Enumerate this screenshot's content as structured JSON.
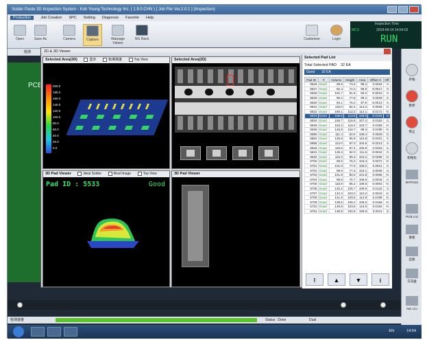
{
  "window": {
    "title": "Solder Paste 3D Inspection System - Koh Young Technology Inc. ( 1.9.0.CHN ) [ Job File Ver.2.0.1 ] (Inspection)"
  },
  "menu": [
    "Production",
    "Job Creation",
    "SPC",
    "Setting",
    "Diagnosis",
    "Favorite",
    "Help"
  ],
  "toolbar": [
    "Open",
    "Save As",
    "Camera",
    "Capture",
    "Warpage Viewer",
    "NG Rack",
    "Customize",
    "Login"
  ],
  "status": {
    "label": "Inspection Time",
    "mode": "MCS",
    "datetime": "2018-04-14 14:54:02",
    "state": "RUN"
  },
  "detect_label": "检测",
  "pcb_label": "PCB",
  "dialog": {
    "title": "2D & 3D Viewer"
  },
  "selected3d": {
    "title": "Selected Area(3D)",
    "opts": [
      "显示",
      "标准高度",
      "Top View"
    ],
    "legend": [
      "200.0",
      "180.0",
      "160.0",
      "140.0",
      "120.0",
      "100.0",
      "80.0",
      "60.0",
      "40.0",
      "20.0",
      "0.0"
    ]
  },
  "selected2d": {
    "title": "Selected Area(2D)"
  },
  "pad3dviewer": {
    "title": "3D Pad Viewer",
    "opts": [
      "Ideal Solder",
      "Real Image",
      "Top View"
    ],
    "pad_id": "Pad ID : 5533",
    "result": "Good"
  },
  "pad2dviewer": {
    "title": "3D Pad Viewer"
  },
  "padlist": {
    "title": "Selected Pad List",
    "total_label": "Total Selected PAD",
    "total_value": "32 EA",
    "filter_label": "Good",
    "filter_value": "32 EA"
  },
  "table": {
    "columns": [
      "Pad ID",
      "#",
      "Volume",
      "Height",
      "Area",
      "Offset X",
      "Off"
    ],
    "rows": [
      [
        "5526",
        "Good",
        "99.5",
        "73.6",
        "98.2",
        "0.0034",
        "0."
      ],
      [
        "5527",
        "Good",
        "92.4",
        "74.3",
        "99.5",
        "-0.0017",
        "0."
      ],
      [
        "5528",
        "Good",
        "101.7",
        "81.9",
        "99.2",
        "-0.0010",
        "0."
      ],
      [
        "5529",
        "Good",
        "96.2",
        "77.5",
        "99.2",
        "0.0028",
        "0."
      ],
      [
        "5530",
        "Good",
        "92.1",
        "75.2",
        "97.9",
        "-0.0013",
        "0."
      ],
      [
        "5531",
        "Good",
        "118.0",
        "82.4",
        "113.2",
        "0.0025",
        "0."
      ],
      [
        "5532",
        "Good",
        "160.1",
        "112.3",
        "114.1",
        "0.0171",
        "-0."
      ],
      [
        "5533",
        "Good",
        "156.5",
        "113.8",
        "109.9",
        "0.0103",
        "0."
      ],
      [
        "5534",
        "Good",
        "155.7",
        "115.8",
        "107.4",
        "0.0162",
        "0."
      ],
      [
        "5535",
        "Good",
        "153.3",
        "119.4",
        "103.7",
        "0.0158",
        "-0."
      ],
      [
        "5536",
        "Good",
        "145.8",
        "116.7",
        "98.3",
        "0.0198",
        "-0."
      ],
      [
        "5580",
        "Good",
        "111.4",
        "83.6",
        "108.4",
        "0.0529",
        "0."
      ],
      [
        "5584",
        "Good",
        "125.8",
        "96.9",
        "115.8",
        "-0.0201",
        "0."
      ],
      [
        "5585",
        "Good",
        "114.0",
        "87.0",
        "104.8",
        "-0.0213",
        "0."
      ],
      [
        "5626",
        "Good",
        "115.6",
        "87.4",
        "105.8",
        "0.0463",
        "0."
      ],
      [
        "5631",
        "Good",
        "128.4",
        "92.0",
        "111.6",
        "-0.0044",
        "0."
      ],
      [
        "5632",
        "Good",
        "116.3",
        "89.3",
        "104.2",
        "-0.0268",
        "-0."
      ],
      [
        "5700",
        "Good",
        "99.5",
        "76.2",
        "103.4",
        "0.0072",
        "-0."
      ],
      [
        "5701",
        "Good",
        "101.0",
        "77.6",
        "105.0",
        "0.0021",
        "0."
      ],
      [
        "5702",
        "Good",
        "99.6",
        "77.3",
        "103.1",
        "0.0028",
        "0."
      ],
      [
        "5703",
        "Good",
        "101.8",
        "80.0",
        "101.8",
        "0.0066",
        "-0."
      ],
      [
        "5704",
        "Good",
        "99.9",
        "75.7",
        "105.6",
        "0.0025",
        "0."
      ],
      [
        "5705",
        "Good",
        "115.9",
        "85.2",
        "108.8",
        "0.0063",
        "-0."
      ],
      [
        "5706",
        "Good",
        "145.2",
        "105.7",
        "109.9",
        "0.0142",
        "0."
      ],
      [
        "5707",
        "Good",
        "142.3",
        "103.3",
        "110.2",
        "0.0043",
        "-0."
      ],
      [
        "5708",
        "Good",
        "141.8",
        "100.5",
        "112.9",
        "0.0199",
        "-0."
      ],
      [
        "5709",
        "Good",
        "139.5",
        "105.2",
        "106.0",
        "0.0166",
        "-0."
      ],
      [
        "5710",
        "Good",
        "149.6",
        "103.6",
        "115.5",
        "0.0184",
        "-0."
      ],
      [
        "5761",
        "Good",
        "135.8",
        "102.6",
        "105.8",
        "0.0211",
        "0."
      ]
    ],
    "selected_index": 7
  },
  "nav": [
    "⭱",
    "▲",
    "▼",
    "⭳"
  ],
  "sidebar": [
    "开始",
    "暂停",
    "停止",
    "初始化",
    "BYPASS",
    "PCB L/U",
    "进板",
    "出板",
    "方向盘",
    "NG L/U"
  ],
  "bottom": {
    "status": "Status : Done",
    "lane": "Dual",
    "progress_label": "检测进度",
    "progress": 0.98
  },
  "taskbar": {
    "time": "14:54",
    "tray": "EN"
  }
}
